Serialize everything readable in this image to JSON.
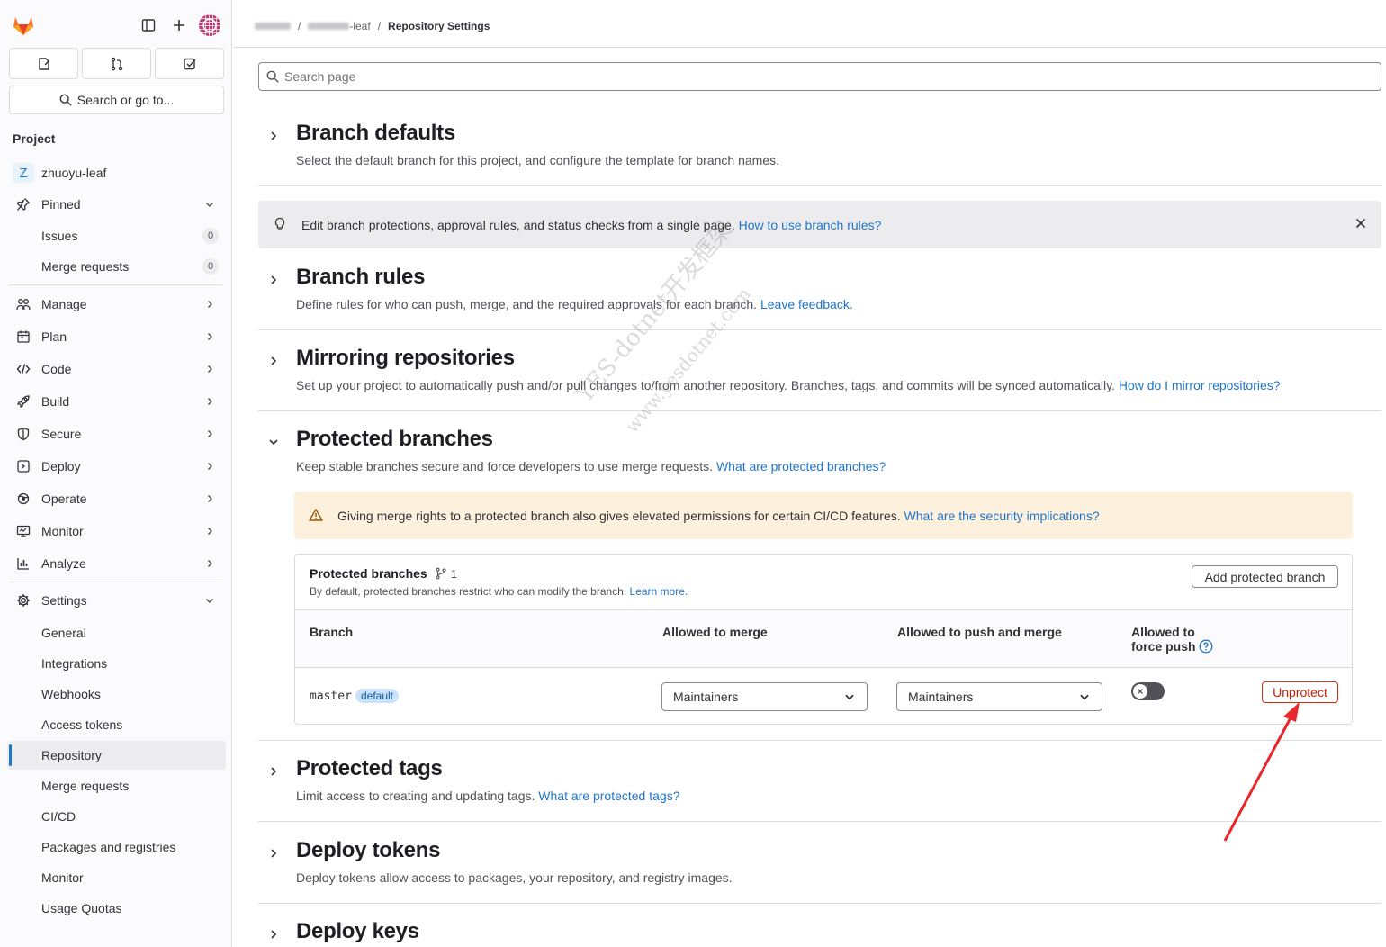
{
  "sidebar": {
    "search_label": "Search or go to...",
    "section_title": "Project",
    "project": {
      "initial": "Z",
      "name": "zhuoyu-leaf"
    },
    "pinned": {
      "label": "Pinned",
      "items": [
        {
          "label": "Issues",
          "count": "0"
        },
        {
          "label": "Merge requests",
          "count": "0"
        }
      ]
    },
    "groups": [
      {
        "label": "Manage",
        "icon": "users-icon"
      },
      {
        "label": "Plan",
        "icon": "calendar-icon"
      },
      {
        "label": "Code",
        "icon": "code-icon"
      },
      {
        "label": "Build",
        "icon": "rocket-icon"
      },
      {
        "label": "Secure",
        "icon": "shield-icon"
      },
      {
        "label": "Deploy",
        "icon": "deploy-icon"
      },
      {
        "label": "Operate",
        "icon": "cloud-gear-icon"
      },
      {
        "label": "Monitor",
        "icon": "monitor-icon"
      },
      {
        "label": "Analyze",
        "icon": "chart-icon"
      }
    ],
    "settings": {
      "label": "Settings",
      "items": [
        "General",
        "Integrations",
        "Webhooks",
        "Access tokens",
        "Repository",
        "Merge requests",
        "CI/CD",
        "Packages and registries",
        "Monitor",
        "Usage Quotas"
      ],
      "active_index": 4
    }
  },
  "breadcrumb": {
    "sep": "/",
    "project_suffix": "-leaf",
    "current": "Repository Settings"
  },
  "search": {
    "placeholder": "Search page"
  },
  "sections": {
    "branch_defaults": {
      "title": "Branch defaults",
      "desc": "Select the default branch for this project, and configure the template for branch names."
    },
    "info_alert": {
      "text": "Edit branch protections, approval rules, and status checks from a single page. ",
      "link": "How to use branch rules?"
    },
    "branch_rules": {
      "title": "Branch rules",
      "desc": "Define rules for who can push, merge, and the required approvals for each branch. ",
      "link": "Leave feedback."
    },
    "mirroring": {
      "title": "Mirroring repositories",
      "desc": "Set up your project to automatically push and/or pull changes to/from another repository. Branches, tags, and commits will be synced automatically. ",
      "link": "How do I mirror repositories?"
    },
    "protected_branches": {
      "title": "Protected branches",
      "desc": "Keep stable branches secure and force developers to use merge requests. ",
      "link": "What are protected branches?",
      "warning": {
        "text": "Giving merge rights to a protected branch also gives elevated permissions for certain CI/CD features. ",
        "link": "What are the security implications?"
      },
      "card": {
        "title": "Protected branches",
        "count": "1",
        "subtitle": "By default, protected branches restrict who can modify the branch. ",
        "subtitle_link": "Learn more.",
        "add_button": "Add protected branch",
        "columns": {
          "branch": "Branch",
          "merge": "Allowed to merge",
          "push": "Allowed to push and merge",
          "force_1": "Allowed to",
          "force_2": "force push"
        },
        "row": {
          "branch": "master",
          "badge": "default",
          "merge": "Maintainers",
          "push": "Maintainers",
          "force_push": false,
          "action": "Unprotect"
        }
      }
    },
    "protected_tags": {
      "title": "Protected tags",
      "desc": "Limit access to creating and updating tags. ",
      "link": "What are protected tags?"
    },
    "deploy_tokens": {
      "title": "Deploy tokens",
      "desc": "Deploy tokens allow access to packages, your repository, and registry images."
    },
    "deploy_keys": {
      "title": "Deploy keys"
    }
  },
  "watermark": {
    "line1": "YES-dotnet开发框架",
    "line2": "www.yesdotnet.com"
  },
  "colors": {
    "accent": "#1f75cb",
    "danger": "#dd2b0e",
    "warning_bg": "#fdf1dd",
    "annotation": "#e8262b"
  }
}
